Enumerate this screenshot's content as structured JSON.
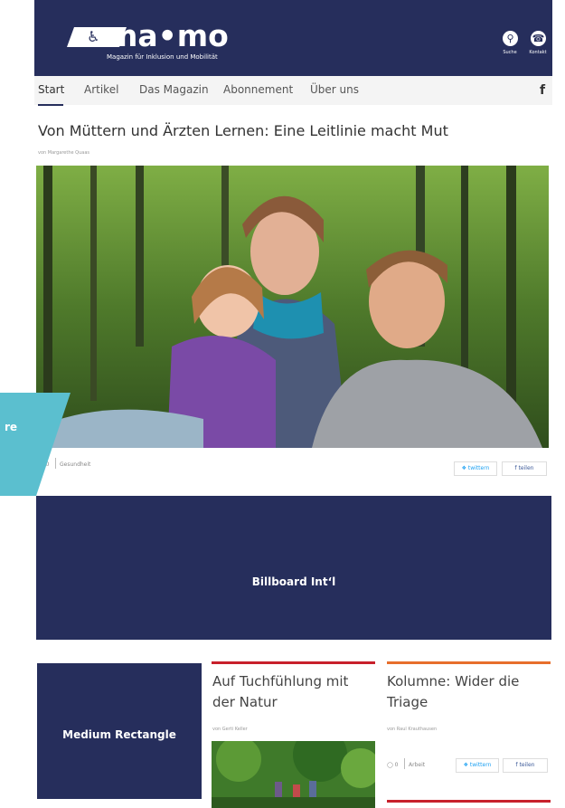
{
  "header": {
    "logo": "ma•mo",
    "logo_mark": "♿",
    "subtitle": "Magazin für Inklusion und Mobilität",
    "search_label": "Suche",
    "contact_label": "Kontakt",
    "search_icon": "search-icon",
    "contact_icon": "phone-icon",
    "bg_color": "#262e5c"
  },
  "nav": {
    "items": [
      {
        "label": "Start"
      },
      {
        "label": "Artikel"
      },
      {
        "label": "Das Magazin"
      },
      {
        "label": "Abonnement"
      },
      {
        "label": "Über uns"
      }
    ],
    "facebook": "f"
  },
  "article": {
    "title": "Von Müttern und Ärzten Lernen: Eine Leitlinie macht Mut",
    "byline": "von Margarethe Quaas",
    "comments": "0",
    "category": "Gesundheit",
    "tweet": "twittern",
    "share": "teilen"
  },
  "overlay": {
    "text": "re",
    "color": "#5bbfcf"
  },
  "ads": {
    "billboard": "Billboard Int‘l",
    "medium_rectangle": "Medium Rectangle"
  },
  "cards": [
    {
      "title": "Auf Tuchfühlung mit der Natur",
      "byline": "von Gerti Keller",
      "bar_color": "#c8202b"
    },
    {
      "title": "Kolumne: Wider die Triage",
      "byline": "von Raul Krauthausen",
      "bar_color": "#e76f2c",
      "comments": "0",
      "category": "Arbeit",
      "tweet": "twittern",
      "share": "teilen"
    }
  ]
}
